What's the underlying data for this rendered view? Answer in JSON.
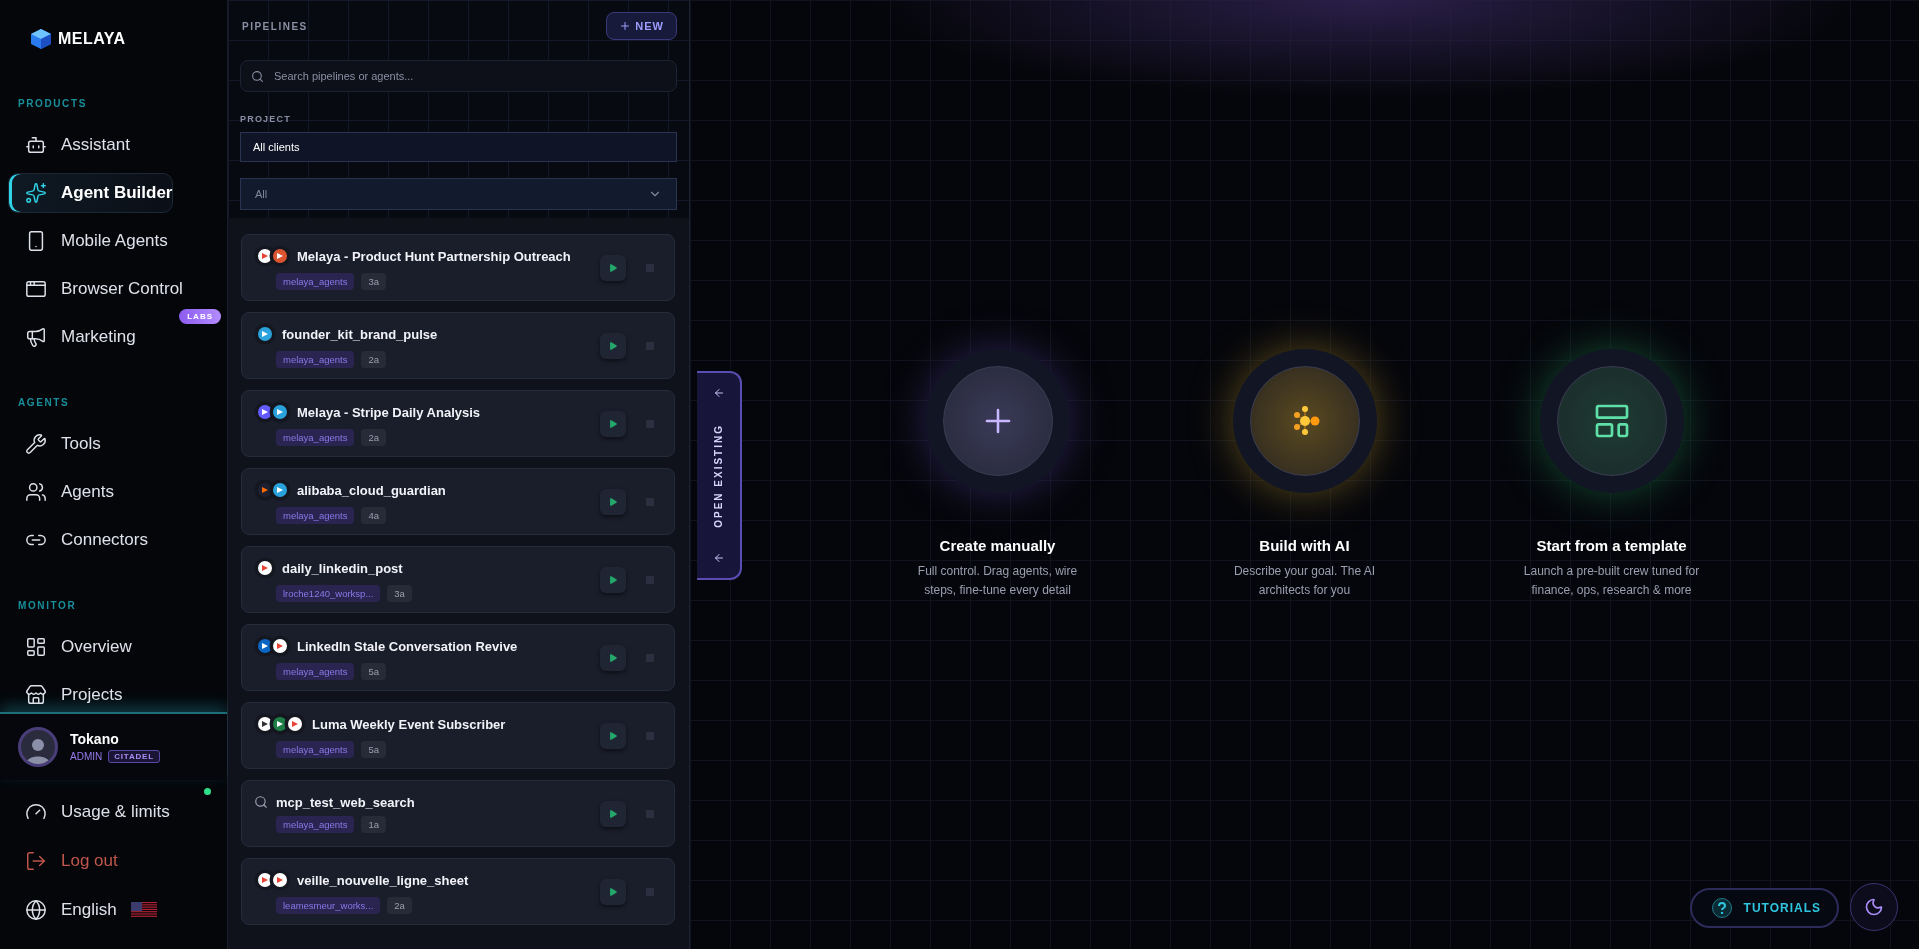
{
  "logo": {
    "text": "MELAYA"
  },
  "sidebar": {
    "sections": [
      {
        "title": "PRODUCTS",
        "items": [
          {
            "label": "Assistant",
            "selected": false
          },
          {
            "label": "Agent Builder",
            "selected": true
          },
          {
            "label": "Mobile Agents",
            "selected": false
          },
          {
            "label": "Browser Control",
            "selected": false
          },
          {
            "label": "Marketing",
            "selected": false,
            "badge": "LABS"
          }
        ]
      },
      {
        "title": "AGENTS",
        "items": [
          {
            "label": "Tools",
            "selected": false
          },
          {
            "label": "Agents",
            "selected": false
          },
          {
            "label": "Connectors",
            "selected": false
          }
        ]
      },
      {
        "title": "MONITOR",
        "items": [
          {
            "label": "Overview",
            "selected": false
          },
          {
            "label": "Projects",
            "selected": false
          }
        ]
      }
    ]
  },
  "user": {
    "name": "Tokano",
    "role": "ADMIN",
    "plan": "CITADEL"
  },
  "footer_items": [
    {
      "label": "Usage & limits",
      "kind": "usage",
      "notification": true
    },
    {
      "label": "Log out",
      "kind": "danger",
      "notification": false
    },
    {
      "label": "English",
      "kind": "language",
      "notification": false
    }
  ],
  "pipelines": {
    "title": "PIPELINES",
    "new_button": "NEW",
    "search": {
      "placeholder": "Search pipelines or agents..."
    },
    "project_label": "PROJECT",
    "project_value": "All clients",
    "filter_value": "All",
    "items": [
      {
        "name": "Melaya - Product Hunt Partnership Outreach",
        "workspace": "melaya_agents",
        "agents": "3a",
        "apps": [
          {
            "kind": "google"
          },
          {
            "kind": "producthunt"
          }
        ]
      },
      {
        "name": "founder_kit_brand_pulse",
        "workspace": "melaya_agents",
        "agents": "2a",
        "apps": [
          {
            "kind": "telegram"
          }
        ]
      },
      {
        "name": "Melaya - Stripe Daily Analysis",
        "workspace": "melaya_agents",
        "agents": "2a",
        "apps": [
          {
            "kind": "stripe"
          },
          {
            "kind": "telegram"
          }
        ]
      },
      {
        "name": "alibaba_cloud_guardian",
        "workspace": "melaya_agents",
        "agents": "4a",
        "apps": [
          {
            "kind": "alibaba"
          },
          {
            "kind": "telegram"
          }
        ]
      },
      {
        "name": "daily_linkedin_post",
        "workspace": "lroche1240_worksp...",
        "agents": "3a",
        "apps": [
          {
            "kind": "google"
          }
        ]
      },
      {
        "name": "LinkedIn Stale Conversation Revive",
        "workspace": "melaya_agents",
        "agents": "5a",
        "apps": [
          {
            "kind": "linkedin"
          },
          {
            "kind": "google"
          }
        ]
      },
      {
        "name": "Luma Weekly Event Subscriber",
        "workspace": "melaya_agents",
        "agents": "5a",
        "apps": [
          {
            "kind": "luma"
          },
          {
            "kind": "sheets"
          },
          {
            "kind": "google"
          }
        ]
      },
      {
        "name": "mcp_test_web_search",
        "workspace": "melaya_agents",
        "agents": "1a",
        "apps": [
          {
            "kind": "search"
          }
        ]
      },
      {
        "name": "veille_nouvelle_ligne_sheet",
        "workspace": "leamesmeur_works...",
        "agents": "2a",
        "apps": [
          {
            "kind": "google"
          },
          {
            "kind": "google"
          }
        ]
      }
    ]
  },
  "open_existing": "OPEN EXISTING",
  "options": [
    {
      "kind": "manual",
      "title": "Create manually",
      "description": "Full control. Drag agents, wire steps, fine-tune every detail"
    },
    {
      "kind": "ai",
      "title": "Build with AI",
      "description": "Describe your goal. The AI architects for you"
    },
    {
      "kind": "template",
      "title": "Start from a template",
      "description": "Launch a pre-built crew tuned for finance, ops, research & more"
    }
  ],
  "tutorials": {
    "label": "TUTORIALS"
  }
}
